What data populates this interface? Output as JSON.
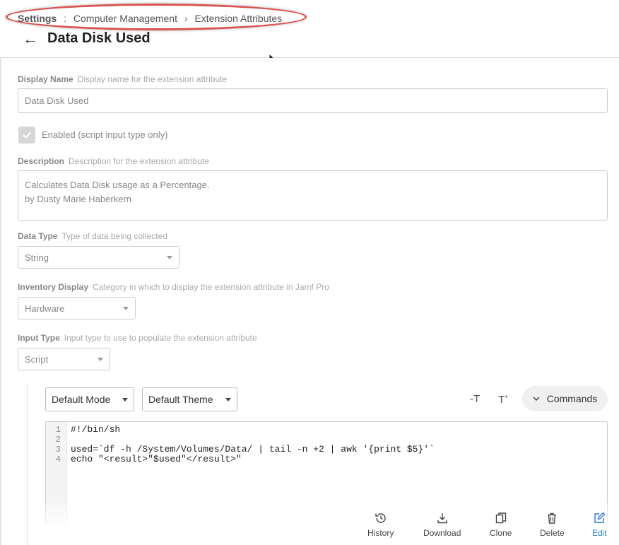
{
  "breadcrumb": {
    "root": "Settings",
    "sep1": ":",
    "section": "Computer Management",
    "sep2": "›",
    "current": "Extension Attributes"
  },
  "page_title": "Data Disk Used",
  "display_name": {
    "label": "Display Name",
    "help": "Display name for the extension attribute",
    "value": "Data Disk Used"
  },
  "enabled": {
    "label": "Enabled (script input type only)",
    "checked": true
  },
  "description": {
    "label": "Description",
    "help": "Description for the extension attribute",
    "line1": "Calculates Data Disk usage as a Percentage.",
    "line2": "by Dusty Marie Haberkern"
  },
  "data_type": {
    "label": "Data Type",
    "help": "Type of data being collected",
    "value": "String"
  },
  "inventory_display": {
    "label": "Inventory Display",
    "help": "Category in which to display the extension attribute in Jamf Pro",
    "value": "Hardware"
  },
  "input_type": {
    "label": "Input Type",
    "help": "Input type to use to populate the extension attribute",
    "value": "Script"
  },
  "editor": {
    "mode": "Default Mode",
    "theme": "Default Theme",
    "commands_label": "Commands",
    "line_numbers": [
      "1",
      "2",
      "3",
      "4"
    ],
    "code": [
      "#!/bin/sh",
      "",
      "used=`df -h /System/Volumes/Data/ | tail -n +2 | awk '{print $5}'`",
      "echo \"<result>\"$used\"</result>\""
    ]
  },
  "actions": {
    "history": "History",
    "download": "Download",
    "clone": "Clone",
    "delete": "Delete",
    "edit": "Edit"
  },
  "colors": {
    "highlight": "#d9534f",
    "accent": "#2f7bd6"
  }
}
